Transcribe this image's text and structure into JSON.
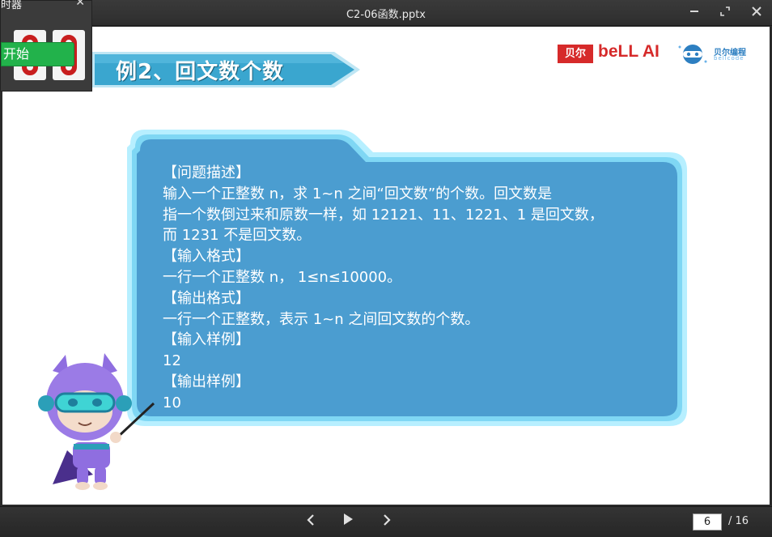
{
  "window": {
    "title": "C2-06函数.pptx",
    "minimize_icon": "minimize-icon",
    "expand_icon": "expand-icon",
    "close_icon": "close-icon"
  },
  "overlay_panel": {
    "title": "时器",
    "close_glyph": "✕",
    "start_label": "开始"
  },
  "slide": {
    "heading": "例2、回文数个数",
    "logo_bell_box": "贝尔",
    "logo_bell_word": "beLL AI",
    "logo_code_cn": "贝尔编程",
    "logo_code_en": "bellcode",
    "lines": [
      "【问题描述】",
      "输入一个正整数 n，求 1~n 之间“回文数”的个数。回文数是",
      "指一个数倒过来和原数一样，如 12121、11、1221、1 是回文数，",
      "而 1231 不是回文数。",
      "【输入格式】",
      "一行一个正整数 n，  1≤n≤10000。",
      "【输出格式】",
      "一行一个正整数，表示 1~n 之间回文数的个数。",
      "【输入样例】",
      "12",
      "【输出样例】",
      "10"
    ]
  },
  "toolbar": {
    "current_page": "6",
    "total_pages": "/ 16"
  },
  "colors": {
    "card_fill": "#4b9dd0",
    "card_glow": "#8fe4ff",
    "banner_fill": "#3aa6cf",
    "brand_red": "#d62a2a",
    "start_green": "#22b24b"
  }
}
